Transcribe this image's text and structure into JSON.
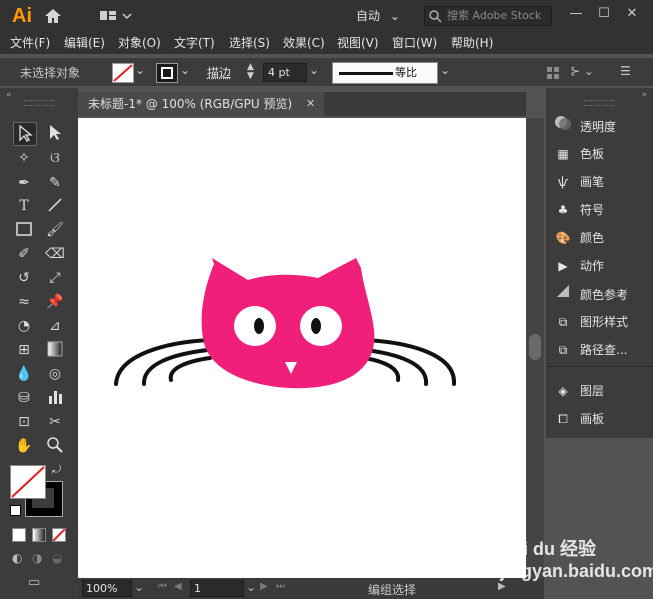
{
  "app": {
    "logo": "Ai",
    "workspace": "自动",
    "search_placeholder": "搜索 Adobe Stock"
  },
  "menu": [
    "文件(F)",
    "编辑(E)",
    "对象(O)",
    "文字(T)",
    "选择(S)",
    "效果(C)",
    "视图(V)",
    "窗口(W)",
    "帮助(H)"
  ],
  "control": {
    "selection_status": "未选择对象",
    "stroke_label": "描边",
    "stroke_value": "4 pt",
    "profile_label": "等比"
  },
  "document": {
    "tab_title": "未标题-1* @ 100% (RGB/GPU 预览)"
  },
  "status": {
    "zoom": "100%",
    "page": "1",
    "mode": "编组选择"
  },
  "panels": [
    {
      "label": "透明度",
      "icon": "transparency-icon"
    },
    {
      "label": "色板",
      "icon": "swatches-icon"
    },
    {
      "label": "画笔",
      "icon": "brushes-icon"
    },
    {
      "label": "符号",
      "icon": "symbols-icon"
    },
    {
      "label": "颜色",
      "icon": "color-icon"
    },
    {
      "label": "动作",
      "icon": "actions-icon"
    },
    {
      "label": "颜色参考",
      "icon": "color-guide-icon"
    },
    {
      "label": "图形样式",
      "icon": "graphic-styles-icon"
    },
    {
      "label": "路径查...",
      "icon": "pathfinder-icon"
    },
    {
      "label": "图层",
      "icon": "layers-icon"
    },
    {
      "label": "画板",
      "icon": "artboards-icon"
    }
  ],
  "watermark": "Bai du 经验 jingyan.baidu.com",
  "colors": {
    "cat_fill": "#ef1f7a",
    "ui_bg": "#535353",
    "panel_bg": "#3c3c3c"
  }
}
